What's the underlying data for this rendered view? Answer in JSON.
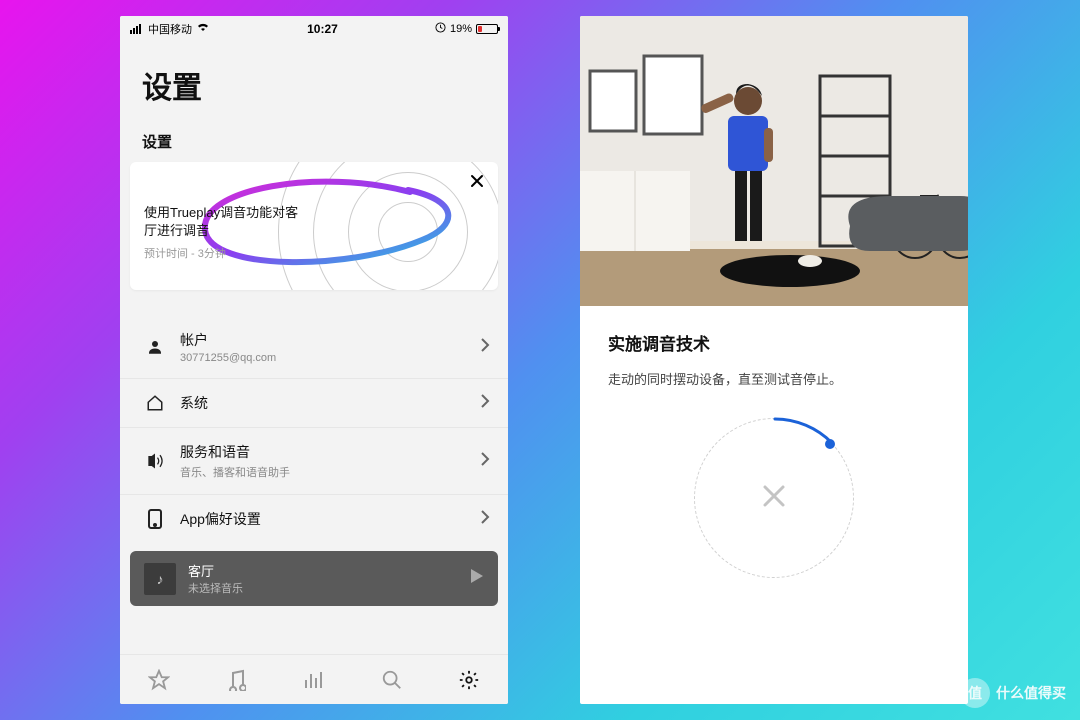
{
  "statusbar": {
    "carrier": "中国移动",
    "time": "10:27",
    "battery_pct": "19%"
  },
  "left": {
    "page_title": "设置",
    "section_title": "设置",
    "card": {
      "title": "使用Trueplay调音功能对客厅进行调音",
      "subtitle": "预计时间 - 3分钟"
    },
    "rows": [
      {
        "icon": "person",
        "title": "帐户",
        "subtitle": "30771255@qq.com"
      },
      {
        "icon": "home",
        "title": "系统",
        "subtitle": ""
      },
      {
        "icon": "voice",
        "title": "服务和语音",
        "subtitle": "音乐、播客和语音助手"
      },
      {
        "icon": "device",
        "title": "App偏好设置",
        "subtitle": ""
      }
    ],
    "nowplaying": {
      "room": "客厅",
      "status": "未选择音乐"
    }
  },
  "right": {
    "title": "实施调音技术",
    "desc": "走动的同时摆动设备，直至测试音停止。"
  },
  "watermark": "什么值得买"
}
